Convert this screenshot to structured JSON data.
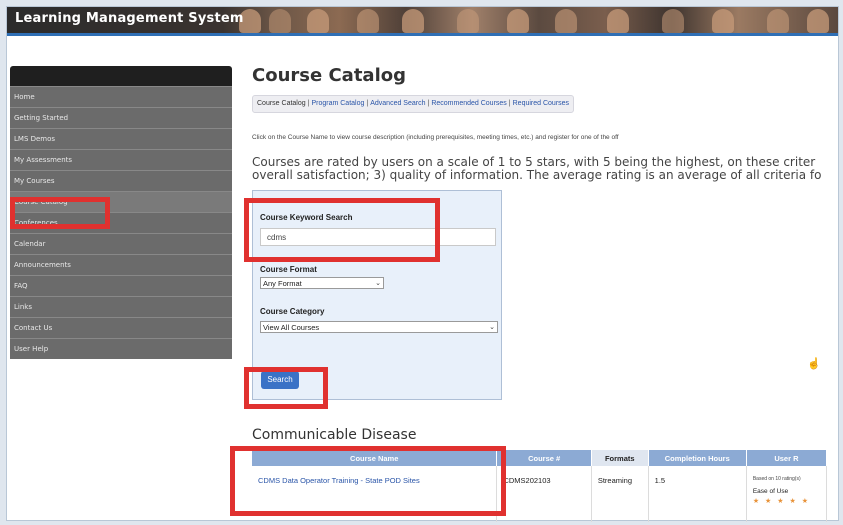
{
  "app": {
    "title": "Learning Management System"
  },
  "sidebar": {
    "items": [
      {
        "label": "Home"
      },
      {
        "label": "Getting Started"
      },
      {
        "label": "LMS Demos"
      },
      {
        "label": "My Assessments"
      },
      {
        "label": "My Courses"
      },
      {
        "label": "Course Catalog"
      },
      {
        "label": "Conferences"
      },
      {
        "label": "Calendar"
      },
      {
        "label": "Announcements"
      },
      {
        "label": "FAQ"
      },
      {
        "label": "Links"
      },
      {
        "label": "Contact Us"
      },
      {
        "label": "User Help"
      }
    ]
  },
  "main": {
    "title": "Course Catalog",
    "catalog_nav": [
      "Course Catalog",
      "Program Catalog",
      "Advanced Search",
      "Recommended Courses",
      "Required Courses"
    ],
    "intro": "Click on the Course Name to view course description (including prerequisites, meeting times, etc.) and register for one of the off",
    "ratings_line1": "Courses are rated by users on a scale of 1 to 5 stars, with 5 being the highest, on these criter",
    "ratings_line2": "overall satisfaction; 3) quality of information. The average rating is an average of all criteria fo"
  },
  "search": {
    "keyword_label": "Course Keyword Search",
    "keyword_value": "cdms",
    "format_label": "Course Format",
    "format_value": "Any Format",
    "category_label": "Course Category",
    "category_value": "View All Courses",
    "button_label": "Search"
  },
  "results": {
    "section_title": "Communicable Disease",
    "columns": [
      "Course Name",
      "Course #",
      "Formats",
      "Completion Hours",
      "User R"
    ],
    "rows": [
      {
        "name": "CDMS Data Operator Training - State POD Sites",
        "number": "CDMS202103",
        "format": "Streaming",
        "hours": "1.5",
        "rating_note": "Based on 10 rating(s)",
        "rating_label": "Ease of Use",
        "stars": "★ ★ ★ ★ ★"
      }
    ]
  },
  "colors": {
    "highlight": "#e0312f",
    "accent": "#3a72c6",
    "sidebar": "#6b6b6b"
  }
}
